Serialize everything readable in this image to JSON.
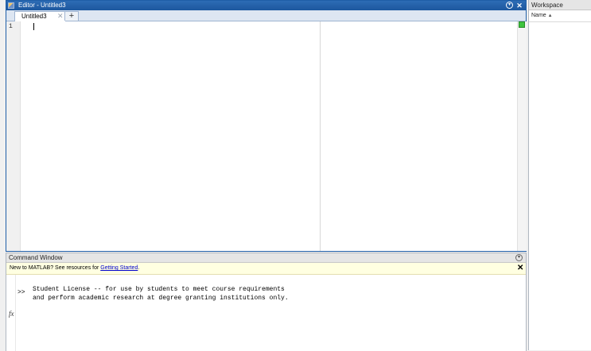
{
  "editor": {
    "title": "Editor - Untitled3",
    "tabs": [
      {
        "label": "Untitled3"
      }
    ],
    "add_tab_label": "+",
    "line_numbers": [
      "1"
    ]
  },
  "command_window": {
    "title": "Command Window",
    "notice": {
      "prefix": "New to MATLAB? See resources for ",
      "link": "Getting Started",
      "suffix": "."
    },
    "output_lines": [
      "Student License -- for use by students to meet course requirements",
      "and perform academic research at degree granting institutions only."
    ],
    "prompt": ">>"
  },
  "workspace": {
    "title": "Workspace",
    "columns": [
      {
        "label": "Name"
      }
    ]
  },
  "icons": {
    "editor_menu": "circle-chevron-down-icon",
    "editor_close": "close-icon",
    "tab_close": "close-icon",
    "status": "status-indicator-icon",
    "fx": "function-browser-icon",
    "sort": "sort-ascending-icon"
  },
  "colors": {
    "titlebar_blue": "#1d579e",
    "notice_bg": "#ffffe1",
    "link": "#0000cc",
    "status_green": "#3ec43e"
  }
}
